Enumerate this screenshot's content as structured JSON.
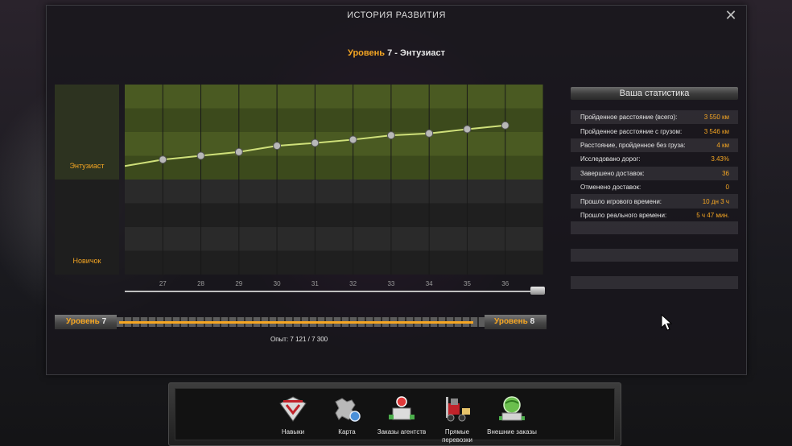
{
  "window": {
    "title": "ИСТОРИЯ РАЗВИТИЯ",
    "close_icon": "close-icon"
  },
  "heading": {
    "prefix": "Уровень",
    "level": "7",
    "rest": "- Энтузиаст"
  },
  "chart": {
    "rank_labels": [
      "Энтузиаст",
      "Новичок"
    ],
    "x_ticks": [
      "27",
      "28",
      "29",
      "30",
      "31",
      "32",
      "33",
      "34",
      "35",
      "36"
    ]
  },
  "chart_data": {
    "type": "line",
    "x": [
      27,
      28,
      29,
      30,
      31,
      32,
      33,
      34,
      35,
      36
    ],
    "y": [
      24.2,
      25.0,
      25.8,
      27.1,
      27.7,
      28.4,
      29.3,
      29.7,
      30.6,
      31.4
    ],
    "xlabel": "",
    "ylabel": "",
    "legend": [],
    "grid": true
  },
  "stats": {
    "header": "Ваша статистика",
    "rows": [
      {
        "label": "Пройденное расстояние (всего):",
        "value": "3 550 км"
      },
      {
        "label": "Пройденное расстояние с грузом:",
        "value": "3 546 км"
      },
      {
        "label": "Расстояние, пройденное без груза:",
        "value": "4 км"
      },
      {
        "label": "Исследовано дорог:",
        "value": "3.43%"
      },
      {
        "label": "Завершено доставок:",
        "value": "36"
      },
      {
        "label": "Отменено доставок:",
        "value": "0"
      },
      {
        "label": "Прошло игрового времени:",
        "value": "10 дн 3 ч"
      },
      {
        "label": "Прошло реального времени:",
        "value": "5 ч 47 мин."
      }
    ]
  },
  "progress": {
    "left_label": "Уровень",
    "left_level": "7",
    "right_label": "Уровень",
    "right_level": "8",
    "fraction": 0.9755,
    "exp_text": "Опыт: 7 121 / 7 300"
  },
  "dock": {
    "items": [
      {
        "label": "Навыки",
        "icon": "skills-icon"
      },
      {
        "label": "Карта",
        "icon": "map-icon"
      },
      {
        "label": "Заказы агентств",
        "icon": "agency-orders-icon"
      },
      {
        "label": "Прямые перевозки",
        "icon": "direct-freight-icon"
      },
      {
        "label": "Внешние заказы",
        "icon": "external-orders-icon"
      }
    ]
  },
  "colors": {
    "accent": "#f5a623",
    "line": "#cfe07a",
    "band": "#4a5a22"
  }
}
